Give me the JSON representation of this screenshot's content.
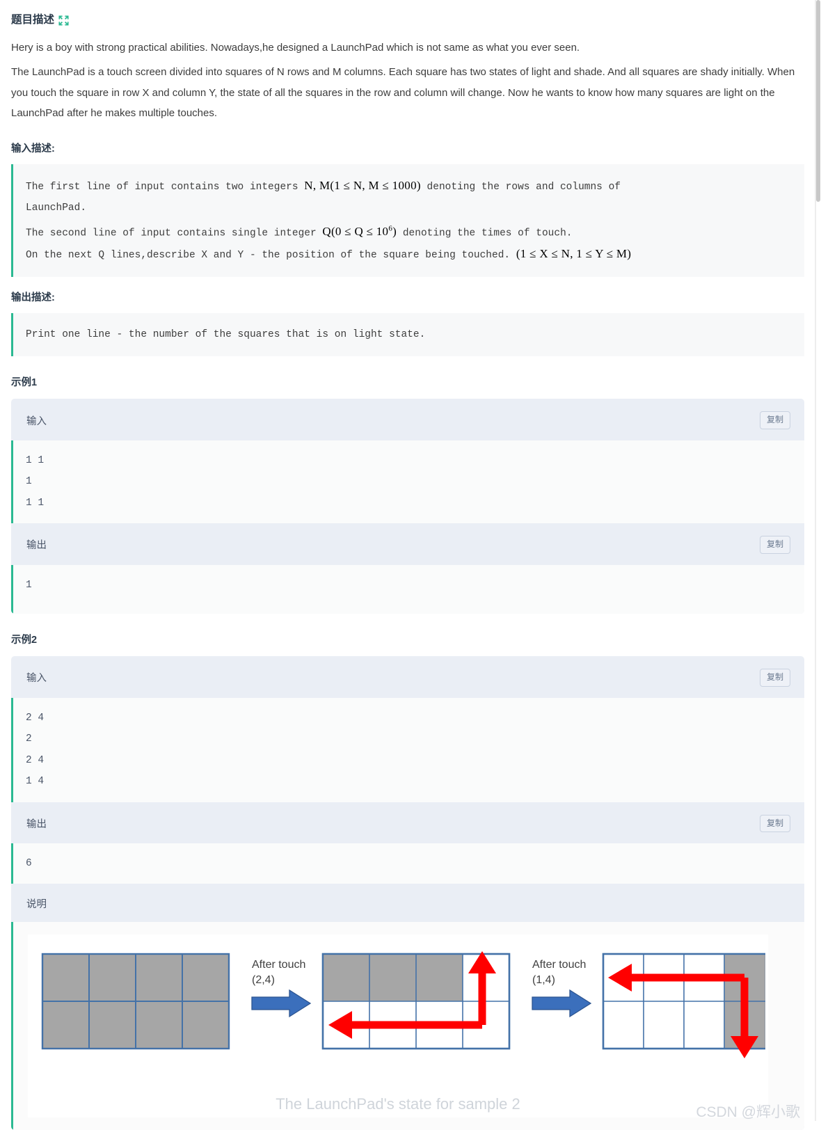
{
  "header": {
    "title": "题目描述",
    "expand_icon": "expand-arrows-icon",
    "accent_color": "#2bb992"
  },
  "description": {
    "lines": [
      "Hery is a boy with strong practical abilities. Nowadays,he designed a LaunchPad which is not same as what you ever seen.",
      "The LaunchPad is a touch screen divided into squares of N rows and M columns. Each square has two states of light and shade. And all squares are shady initially. When you touch the square in row X and column Y, the state of all the squares in the row and column will change. Now he wants to know how many squares are light on the LaunchPad after he makes multiple touches."
    ]
  },
  "input_section": {
    "heading": "输入描述:",
    "line1_a": "The first line of input contains two integers ",
    "line1_math": "N, M(1 ≤ N, M ≤ 1000)",
    "line1_b": " denoting the rows and columns of",
    "line2": "LaunchPad.",
    "line3_a": "The second line of input contains single integer ",
    "line3_math": "Q(0 ≤ Q ≤ 10",
    "line3_math_sup": "6",
    "line3_math_end": ")",
    "line3_b": " denoting the times of touch.",
    "line4_a": "On the next Q lines,describe X and Y - the position of the square being touched. ",
    "line4_math": "(1 ≤ X ≤ N, 1 ≤ Y ≤ M)"
  },
  "output_section": {
    "heading": "输出描述:",
    "text": "Print one line - the number of the squares that is on light state."
  },
  "examples": [
    {
      "title": "示例1",
      "input_label": "输入",
      "input_copy": "复制",
      "input_lines": [
        "1 1",
        "1",
        "1 1"
      ],
      "output_label": "输出",
      "output_copy": "复制",
      "output_lines": [
        "1"
      ]
    },
    {
      "title": "示例2",
      "input_label": "输入",
      "input_copy": "复制",
      "input_lines": [
        "2 4",
        "2",
        "2 4",
        "1 4"
      ],
      "output_label": "输出",
      "output_copy": "复制",
      "output_lines": [
        "6"
      ],
      "note_label": "说明",
      "figure": {
        "caption": "The LaunchPad's state for sample 2",
        "grid_cols": 4,
        "grid_rows": 2,
        "shade_color": "#a6a6a6",
        "light_color": "#ffffff",
        "border_color": "#4472a8",
        "arrow_blue": "#3b6fbc",
        "arrow_red": "#ff0000",
        "steps": [
          {
            "id": "initial",
            "cells": [
              [
                "shade",
                "shade",
                "shade",
                "shade"
              ],
              [
                "shade",
                "shade",
                "shade",
                "shade"
              ]
            ],
            "label": "",
            "sub": ""
          },
          {
            "id": "after-2-4",
            "label": "After touch",
            "sub": "(2,4)",
            "cells": [
              [
                "shade",
                "shade",
                "shade",
                "light"
              ],
              [
                "light",
                "light",
                "light",
                "light"
              ]
            ],
            "touch_row": 2,
            "touch_col": 4
          },
          {
            "id": "after-1-4",
            "label": "After touch",
            "sub": "(1,4)",
            "cells": [
              [
                "light",
                "light",
                "light",
                "shade"
              ],
              [
                "light",
                "light",
                "light",
                "shade"
              ]
            ],
            "touch_row": 1,
            "touch_col": 4
          }
        ]
      }
    }
  ],
  "watermark": "CSDN @辉小歌"
}
